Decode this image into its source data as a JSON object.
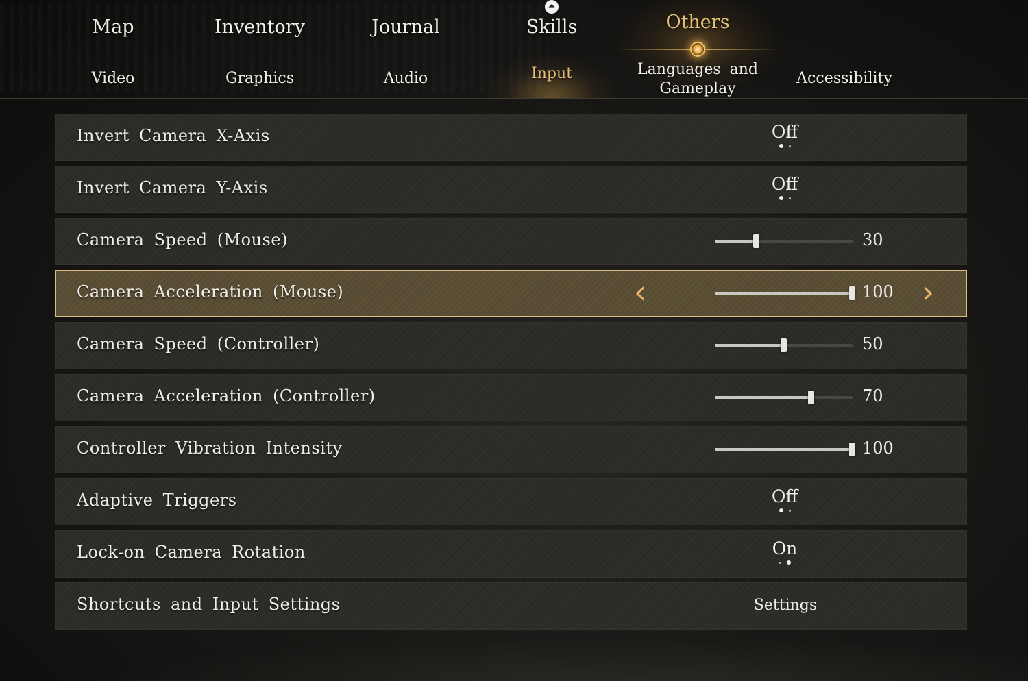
{
  "top_nav": {
    "tabs": [
      {
        "label": "Map",
        "active": false
      },
      {
        "label": "Inventory",
        "active": false
      },
      {
        "label": "Journal",
        "active": false
      },
      {
        "label": "Skills",
        "active": false
      },
      {
        "label": "Others",
        "active": true
      }
    ],
    "skills_icon": "up-arrow-badge-icon"
  },
  "sub_nav": {
    "tabs": [
      {
        "label": "Video",
        "active": false
      },
      {
        "label": "Graphics",
        "active": false
      },
      {
        "label": "Audio",
        "active": false
      },
      {
        "label": "Input",
        "active": true
      },
      {
        "label": "Languages and Gameplay",
        "active": false
      },
      {
        "label": "Accessibility",
        "active": false
      }
    ]
  },
  "colors": {
    "accent": "#e4bf78",
    "selected_border": "#d8bf85",
    "row_bg": "#2d2c29"
  },
  "settings": [
    {
      "label": "Invert Camera X-Axis",
      "type": "toggle",
      "value": "Off",
      "state_index": 0
    },
    {
      "label": "Invert Camera Y-Axis",
      "type": "toggle",
      "value": "Off",
      "state_index": 0
    },
    {
      "label": "Camera Speed (Mouse)",
      "type": "slider",
      "value": "30",
      "fraction": 0.3
    },
    {
      "label": "Camera Acceleration (Mouse)",
      "type": "slider",
      "value": "100",
      "fraction": 1.0,
      "selected": true
    },
    {
      "label": "Camera Speed (Controller)",
      "type": "slider",
      "value": "50",
      "fraction": 0.5
    },
    {
      "label": "Camera Acceleration (Controller)",
      "type": "slider",
      "value": "70",
      "fraction": 0.7
    },
    {
      "label": "Controller Vibration Intensity",
      "type": "slider",
      "value": "100",
      "fraction": 1.0
    },
    {
      "label": "Adaptive Triggers",
      "type": "toggle",
      "value": "Off",
      "state_index": 0
    },
    {
      "label": "Lock-on Camera Rotation",
      "type": "toggle",
      "value": "On",
      "state_index": 1
    },
    {
      "label": "Shortcuts and Input Settings",
      "type": "button",
      "value": "Settings"
    }
  ],
  "selector_icons": {
    "left": "chevron-left-icon",
    "right": "chevron-right-icon"
  }
}
